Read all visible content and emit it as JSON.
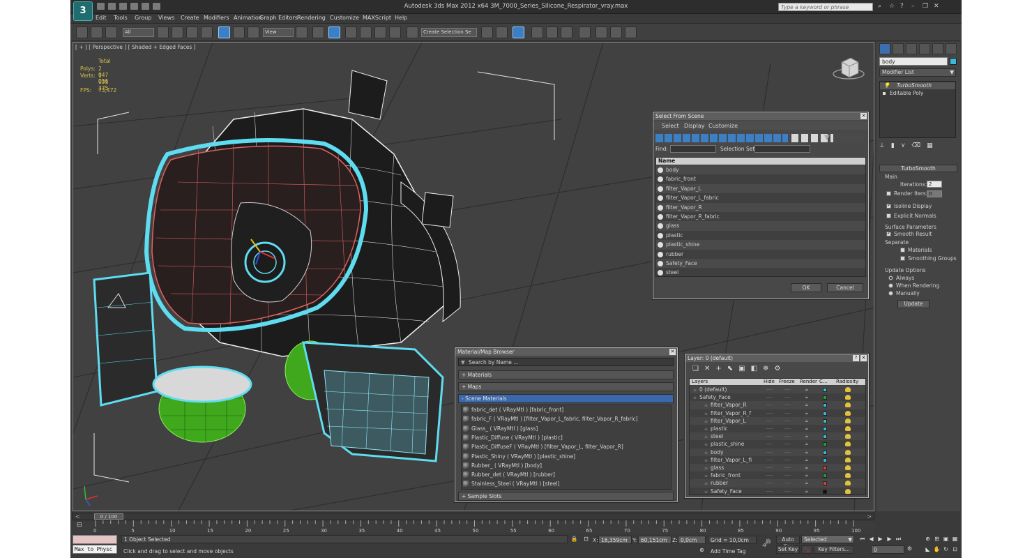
{
  "title_bar": {
    "app_title": "Autodesk 3ds Max  2012 x64     3M_7000_Series_Silicone_Respirator_vray.max",
    "logo_letter": "3",
    "search_placeholder": "Type a keyword or phrase"
  },
  "menu": [
    "Edit",
    "Tools",
    "Group",
    "Views",
    "Create",
    "Modifiers",
    "Animation",
    "Graph Editors",
    "Rendering",
    "Customize",
    "MAXScript",
    "Help"
  ],
  "toolbar": {
    "filter_value": "All",
    "coord_value": "View",
    "selection_set_value": "Create Selection Se"
  },
  "viewport": {
    "label": "[ + ] [ Perspective ] [ Shaded + Edged Faces ]",
    "stats": {
      "total_label": "Total",
      "polys_label": "Polys:",
      "polys_value": "2 047 056",
      "verts_label": "Verts:",
      "verts_value": "1 031 375",
      "fps_label": "FPS:",
      "fps_value": "73,472"
    }
  },
  "command_panel": {
    "object_name": "body",
    "modifier_list_label": "Modifier List",
    "stack": [
      "TurboSmooth",
      "Editable Poly"
    ],
    "rollout_title": "TurboSmooth",
    "main_label": "Main",
    "iterations_label": "Iterations:",
    "iterations_value": "2",
    "render_iters_label": "Render Iters:",
    "render_iters_value": "0",
    "isoline_label": "Isoline Display",
    "explicit_normals_label": "Explicit Normals",
    "surface_params_label": "Surface Parameters",
    "smooth_result_label": "Smooth Result",
    "separate_label": "Separate",
    "materials_label": "Materials",
    "smoothing_groups_label": "Smoothing Groups",
    "update_options_label": "Update Options",
    "always_label": "Always",
    "when_rendering_label": "When Rendering",
    "manually_label": "Manually",
    "update_button": "Update"
  },
  "select_from_scene": {
    "title": "Select From Scene",
    "menu": [
      "Select",
      "Display",
      "Customize"
    ],
    "find_label": "Find:",
    "selection_set_label": "Selection Set:",
    "column_name": "Name",
    "items": [
      "body",
      "fabric_front",
      "filter_Vapor_L",
      "filter_Vapor_L_fabric",
      "filter_Vapor_R",
      "filter_Vapor_R_fabric",
      "glass",
      "plastic",
      "plastic_shine",
      "rubber",
      "Safety_Face",
      "steel"
    ],
    "ok_label": "OK",
    "cancel_label": "Cancel"
  },
  "material_browser": {
    "title": "Material/Map Browser",
    "search_placeholder": "Search by Name ...",
    "groups": [
      "+ Materials",
      "+ Maps",
      "- Scene Materials",
      "+ Sample Slots"
    ],
    "materials": [
      "fabric_det  ( VRayMtl ) [fabric_front]",
      "fabric_F  ( VRayMtl ) [filter_Vapor_L_fabric, filter_Vapor_R_fabric]",
      "Glass_  ( VRayMtl ) [glass]",
      "Plastic_Diffuse  ( VRayMtl ) [plastic]",
      "Plastic_DiffuseF  ( VRayMtl ) [filter_Vapor_L, filter_Vapor_R]",
      "Plastic_Shiny  ( VRayMtl ) [plastic_shine]",
      "Rubber_  ( VRayMtl ) [body]",
      "Rubber_det  ( VRayMtl ) [rubber]",
      "Stainless_Steel  ( VRayMtl ) [steel]"
    ]
  },
  "layer_manager": {
    "title": "Layer: 0 (default)",
    "help": "?",
    "columns": [
      "Layers",
      "Hide",
      "Freeze",
      "Render",
      "C...",
      "Radiosity"
    ],
    "rows": [
      {
        "name": "0 (default)",
        "indent": 1,
        "color": "#3ab8d8"
      },
      {
        "name": "Safety_Face",
        "indent": 1,
        "color": "#1f9e3a"
      },
      {
        "name": "filter_Vapor_R",
        "indent": 2,
        "color": "#3ab8d8"
      },
      {
        "name": "filter_Vapor_R_f",
        "indent": 2,
        "color": "#3ab8d8"
      },
      {
        "name": "filter_Vapor_L",
        "indent": 2,
        "color": "#3ab8d8"
      },
      {
        "name": "plastic",
        "indent": 2,
        "color": "#3ab8d8"
      },
      {
        "name": "steel",
        "indent": 2,
        "color": "#3ab8d8"
      },
      {
        "name": "plastic_shine",
        "indent": 2,
        "color": "#1f9e3a"
      },
      {
        "name": "body",
        "indent": 2,
        "color": "#3ab8d8"
      },
      {
        "name": "filter_Vapor_L_fi",
        "indent": 2,
        "color": "#3ab8d8"
      },
      {
        "name": "glass",
        "indent": 2,
        "color": "#d84040"
      },
      {
        "name": "fabric_front",
        "indent": 2,
        "color": "#1f9e3a"
      },
      {
        "name": "rubber",
        "indent": 2,
        "color": "#d84040"
      },
      {
        "name": "Safety_Face",
        "indent": 2,
        "color": "#111111"
      }
    ]
  },
  "timeline": {
    "frame_label": "0 / 100",
    "ticks": [
      "0",
      "5",
      "10",
      "15",
      "20",
      "25",
      "30",
      "35",
      "40",
      "45",
      "50",
      "55",
      "60",
      "65",
      "70",
      "75",
      "80",
      "85",
      "90",
      "95",
      "100"
    ]
  },
  "status": {
    "script_listener": "Max to Physc",
    "selected_count": "1 Object Selected",
    "prompt": "Click and drag to select and move objects",
    "x_label": "X:",
    "x_value": "16,359cm",
    "y_label": "Y:",
    "y_value": "60,151cm",
    "z_label": "Z:",
    "z_value": "0,0cm",
    "grid": "Grid = 10,0cm",
    "add_time_tag": "Add Time Tag",
    "auto_key": "Auto Key",
    "set_key": "Set Key",
    "key_mode": "Selected",
    "key_filters": "Key Filters...",
    "current_frame": "0"
  },
  "colors": {
    "wire_cyan": "#5fdcf0",
    "wire_white": "#f0f0f0",
    "wire_red": "#e06060",
    "filter_green": "#3fa81c",
    "viewport_bg": "#414141",
    "selection_blue": "#3b68ad"
  }
}
